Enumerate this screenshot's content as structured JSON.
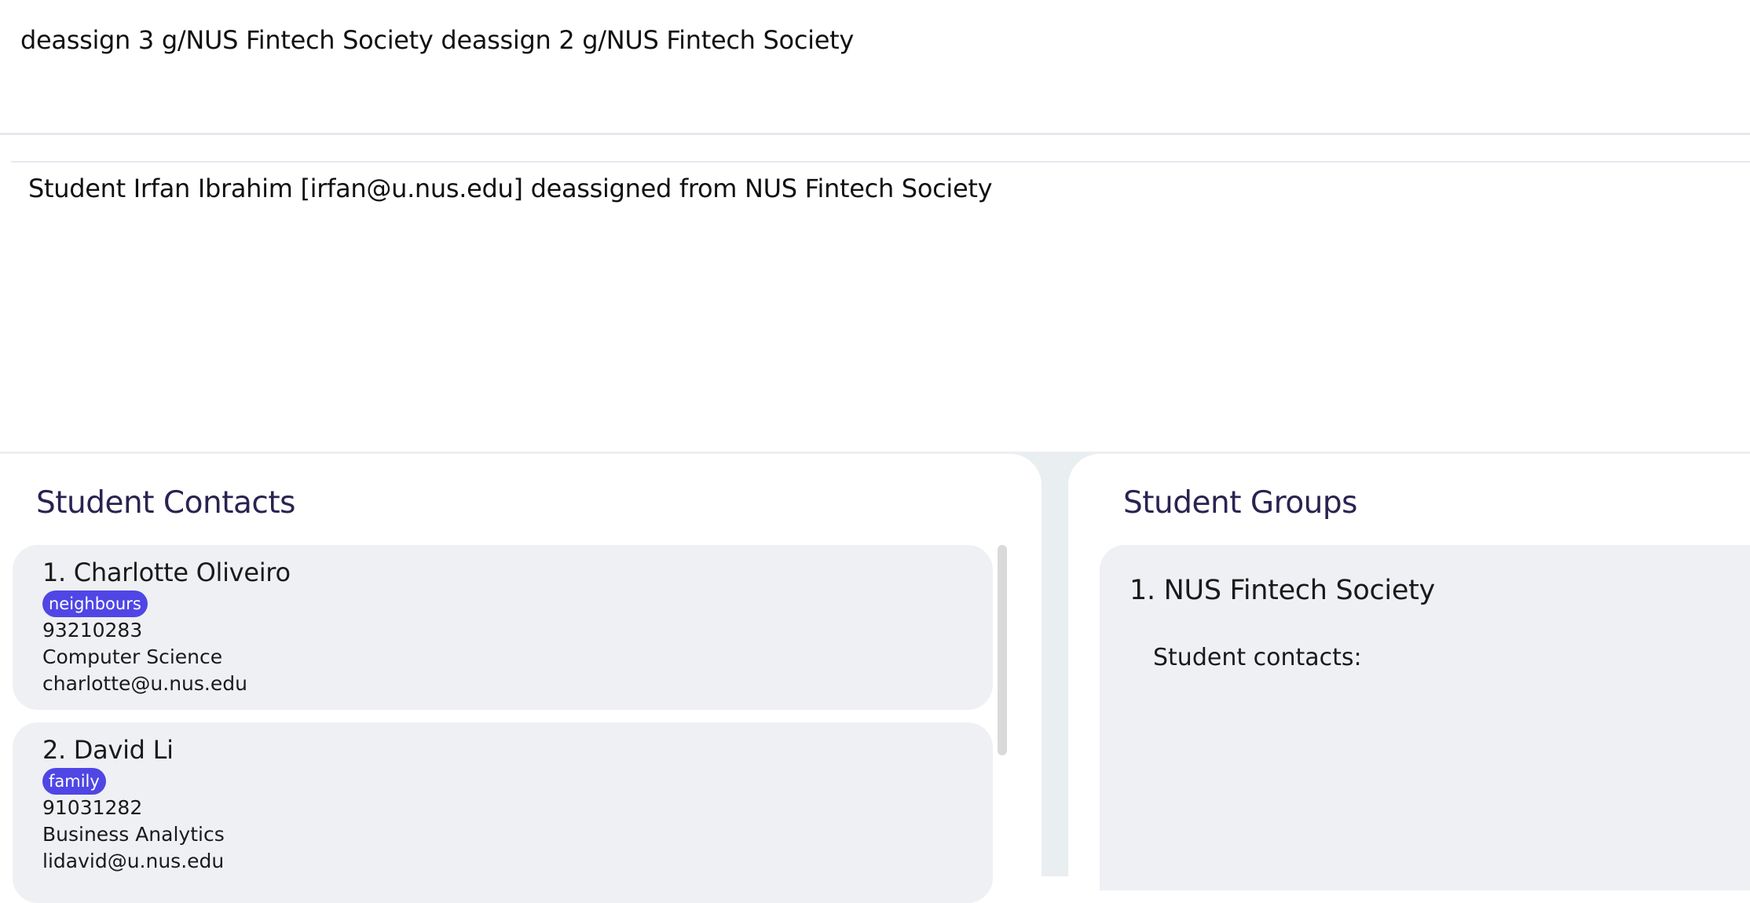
{
  "command": {
    "input_value": "deassign 3 g/NUS Fintech Society deassign 2 g/NUS Fintech Society"
  },
  "result": {
    "message": "Student Irfan Ibrahim [irfan@u.nus.edu] deassigned from NUS Fintech Society"
  },
  "contacts_panel": {
    "title": "Student Contacts",
    "items": [
      {
        "index_name": "1.  Charlotte Oliveiro",
        "tag": "neighbours",
        "phone": "93210283",
        "major": "Computer Science",
        "email": "charlotte@u.nus.edu"
      },
      {
        "index_name": "2.  David Li",
        "tag": "family",
        "phone": "91031282",
        "major": "Business Analytics",
        "email": "lidavid@u.nus.edu"
      }
    ]
  },
  "groups_panel": {
    "title": "Student Groups",
    "items": [
      {
        "index_name": "1.  NUS Fintech Society",
        "contacts_label": "Student contacts:"
      }
    ]
  },
  "colors": {
    "tag_bg": "#4f46e5",
    "title_text": "#2a2350",
    "card_bg": "#eff0f4"
  }
}
